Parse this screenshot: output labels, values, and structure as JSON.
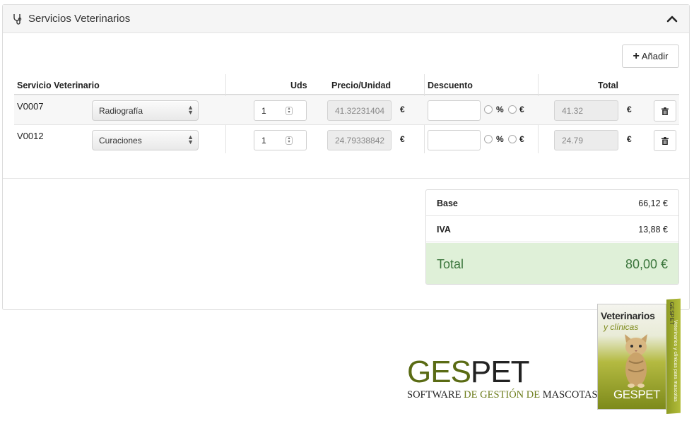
{
  "panel": {
    "title": "Servicios Veterinarios",
    "header_icon": "stethoscope-icon",
    "collapse_icon": "chevron-up-icon"
  },
  "add_button": {
    "label": "Añadir",
    "icon": "plus-icon"
  },
  "table": {
    "columns": [
      "Servicio Veterinario",
      "Uds",
      "Precio/Unidad",
      "Descuento",
      "Total"
    ],
    "rows": [
      {
        "code": "V0007",
        "service": "Radiografía",
        "qty": "1",
        "unit_price": "41.32231404",
        "unit_currency": "€",
        "discount": "",
        "pct_label": "%",
        "eur_label": "€",
        "total": "41.32",
        "total_currency": "€"
      },
      {
        "code": "V0012",
        "service": "Curaciones",
        "qty": "1",
        "unit_price": "24.79338842",
        "unit_currency": "€",
        "discount": "",
        "pct_label": "%",
        "eur_label": "€",
        "total": "24.79",
        "total_currency": "€"
      }
    ]
  },
  "summary": {
    "base_label": "Base",
    "base_value": "66,12 €",
    "iva_label": "IVA",
    "iva_value": "13,88 €",
    "total_label": "Total",
    "total_value": "80,00 €"
  },
  "brand": {
    "logo_ges": "GES",
    "logo_pet": "PET",
    "tagline_1": "SOFTWARE",
    "tagline_2": "DE GESTIÓN DE",
    "tagline_3": "MASCOTAS",
    "box_title": "Veterinarios",
    "box_subtitle": "y clínicas",
    "box_logo": "GESPET",
    "box_side_text": "Veterinarios y clínicas para mascotas",
    "box_side_logo": "GESPET"
  },
  "colors": {
    "success_bg": "#dff0d8",
    "success_text": "#3c763d",
    "brand_green": "#5a6b14"
  }
}
